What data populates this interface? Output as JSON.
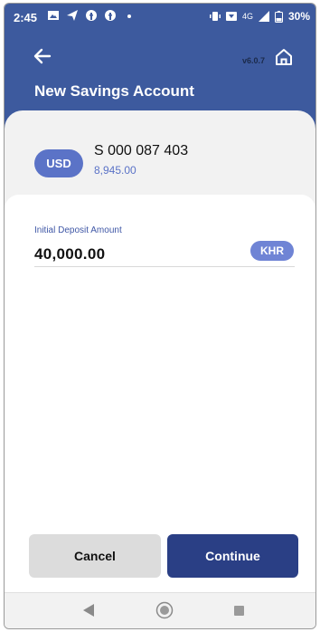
{
  "status_bar": {
    "time": "2:45",
    "network": "4G",
    "battery": "30%"
  },
  "header": {
    "version": "v6.0.7",
    "title": "New Savings Account",
    "color": "#3d5a9e"
  },
  "account": {
    "currency": "USD",
    "number": "S 000 087 403",
    "balance": "8,945.00"
  },
  "form": {
    "deposit_label": "Initial Deposit Amount",
    "deposit_value": "40,000.00",
    "deposit_currency": "KHR"
  },
  "actions": {
    "cancel_label": "Cancel",
    "continue_label": "Continue"
  },
  "colors": {
    "accent": "#5b73c7",
    "primary_button": "#2a3f85",
    "secondary_button": "#dcdcdc"
  },
  "icons": {
    "back": "arrow-left-icon",
    "home": "home-icon",
    "nav_back": "triangle-back-icon",
    "nav_home": "circle-home-icon",
    "nav_recent": "square-recent-icon"
  }
}
